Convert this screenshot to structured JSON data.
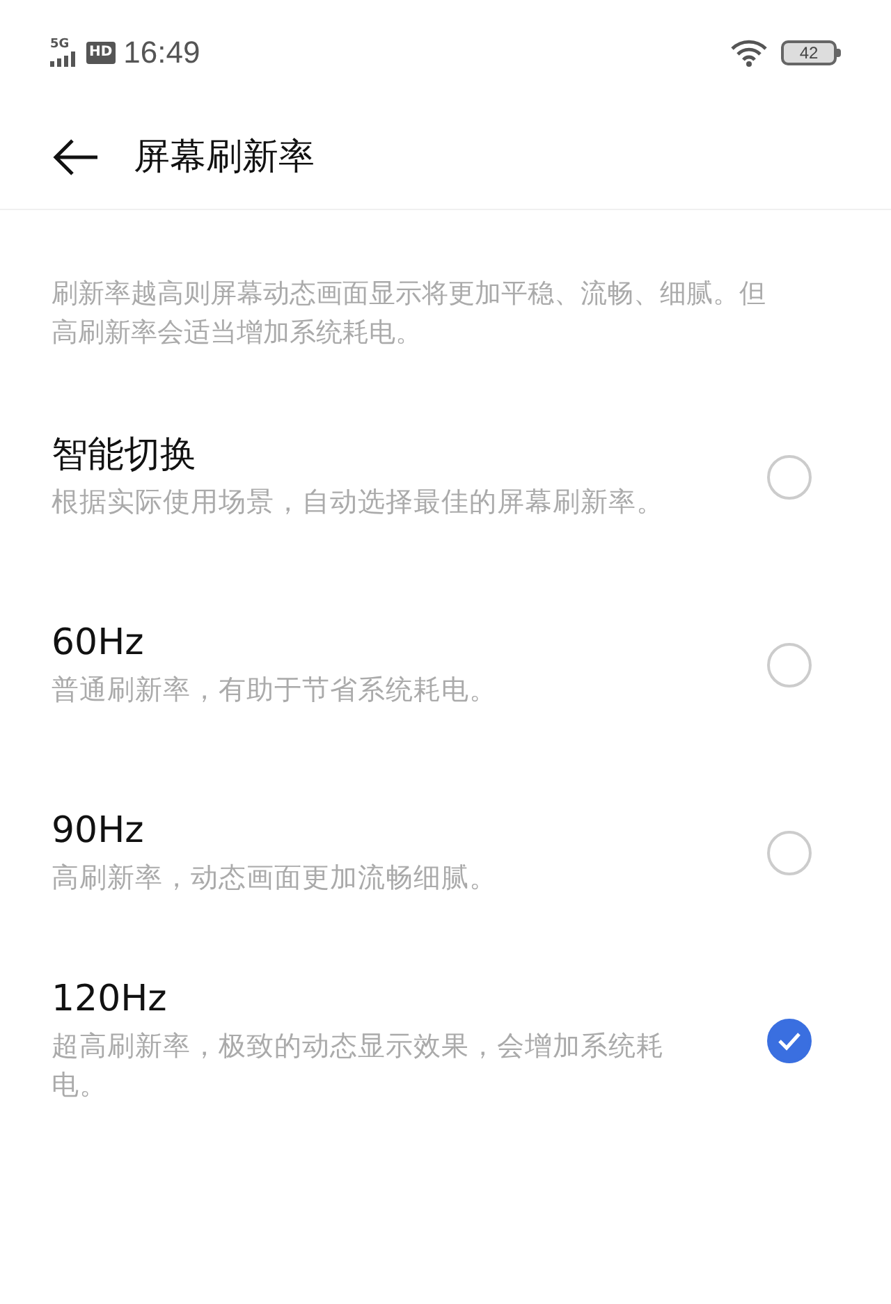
{
  "status_bar": {
    "network": "5G",
    "hd_badge": "HD",
    "time": "16:49",
    "battery": "42"
  },
  "header": {
    "title": "屏幕刷新率"
  },
  "description": "刷新率越高则屏幕动态画面显示将更加平稳、流畅、细腻。但高刷新率会适当增加系统耗电。",
  "options": [
    {
      "title": "智能切换",
      "subtitle": "根据实际使用场景，自动选择最佳的屏幕刷新率。",
      "selected": false
    },
    {
      "title": "60Hz",
      "subtitle": "普通刷新率，有助于节省系统耗电。",
      "selected": false
    },
    {
      "title": "90Hz",
      "subtitle": "高刷新率，动态画面更加流畅细腻。",
      "selected": false
    },
    {
      "title": "120Hz",
      "subtitle": "超高刷新率，极致的动态显示效果，会增加系统耗电。",
      "selected": true
    }
  ]
}
